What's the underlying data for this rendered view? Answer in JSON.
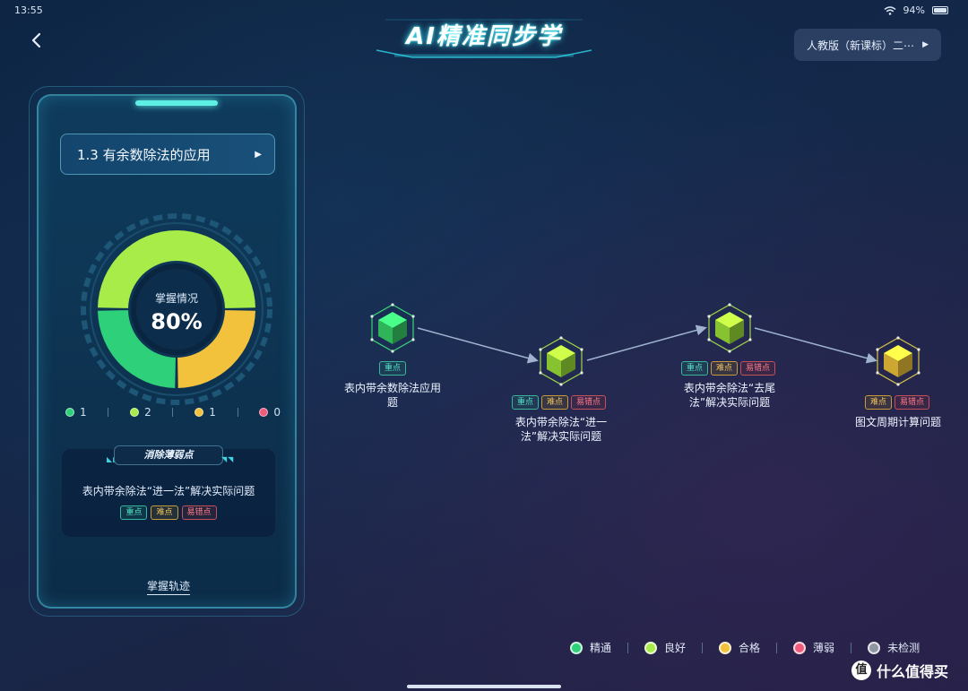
{
  "status_bar": {
    "time": "13:55",
    "battery": "94%"
  },
  "header": {
    "title": "AI精准同步学",
    "edition": "人教版（新课标）二⋯"
  },
  "lesson": {
    "title": "1.3 有余数除法的应用"
  },
  "mastery": {
    "label": "掌握情况",
    "percent_text": "80%",
    "percent": 80,
    "segments": [
      {
        "level": "精通",
        "color": "#2fd07a",
        "count": 1
      },
      {
        "level": "良好",
        "color": "#a8ec4a",
        "count": 2
      },
      {
        "level": "合格",
        "color": "#f2c23c",
        "count": 1
      },
      {
        "level": "薄弱",
        "color": "#ef5b7a",
        "count": 0
      }
    ],
    "counts": [
      "1",
      "2",
      "1",
      "0"
    ]
  },
  "weak_point": {
    "heading": "消除薄弱点",
    "text": "表内带余除法“进一法”解决实际问题",
    "tags": [
      "重点",
      "难点",
      "易错点"
    ]
  },
  "track_link": "掌握轨迹",
  "tag_labels": {
    "key": "重点",
    "hard": "难点",
    "err": "易错点"
  },
  "nodes": [
    {
      "label_line1": "表内带余数除法应用",
      "label_line2": "题",
      "level": "精通",
      "color": "#38d46a",
      "tags": [
        "重点"
      ]
    },
    {
      "label_line1": "表内带余除法“进一",
      "label_line2": "法”解决实际问题",
      "level": "良好",
      "color": "#9fe43a",
      "tags": [
        "重点",
        "难点",
        "易错点"
      ]
    },
    {
      "label_line1": "表内带余除法“去尾",
      "label_line2": "法”解决实际问题",
      "level": "良好",
      "color": "#9fe43a",
      "tags": [
        "重点",
        "难点",
        "易错点"
      ]
    },
    {
      "label_line1": "图文周期计算问题",
      "label_line2": "",
      "level": "合格",
      "color": "#f0c43a",
      "tags": [
        "难点",
        "易错点"
      ]
    }
  ],
  "legend": [
    {
      "label": "精通",
      "color": "#2fd07a"
    },
    {
      "label": "良好",
      "color": "#a8ec4a"
    },
    {
      "label": "合格",
      "color": "#f2c23c"
    },
    {
      "label": "薄弱",
      "color": "#ef5b7a"
    },
    {
      "label": "未检测",
      "color": "#8f96a3"
    }
  ],
  "watermark": {
    "icon": "值",
    "text": "什么值得买"
  },
  "icons": {
    "back": "chevron-left-icon",
    "wifi": "wifi-icon",
    "battery": "battery-icon",
    "dropdown": "caret-right-icon"
  }
}
